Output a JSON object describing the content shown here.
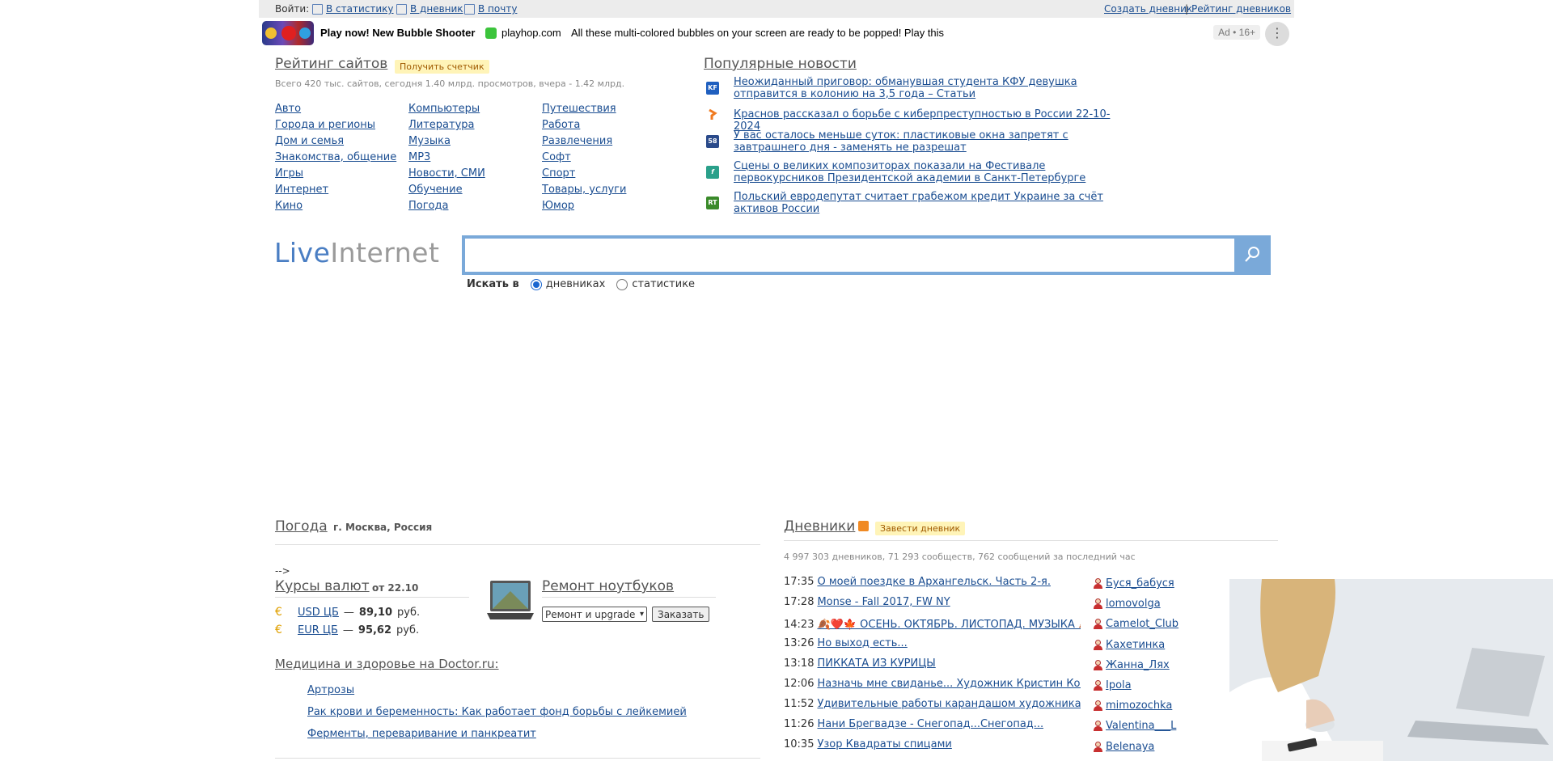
{
  "topbar": {
    "login_label": "Войти:",
    "links": [
      "В статистику",
      "В дневник",
      "В почту"
    ],
    "right_links": [
      "Создать дневник",
      "Рейтинг дневников"
    ],
    "separator": "|"
  },
  "ad": {
    "title": "Play now! New Bubble Shooter",
    "domain": "playhop.com",
    "description": "All these multi-colored bubbles on your screen are ready to be popped! Play this",
    "badge": "Ad • 16+",
    "menu_icon": "⋮"
  },
  "rating": {
    "title": "Рейтинг сайтов",
    "counter_button": "Получить счетчик",
    "stats": "Всего 420 тыс. сайтов, сегодня 1.40 млрд. просмотров, вчера - 1.42 млрд.",
    "categories": [
      [
        "Авто",
        "Города и регионы",
        "Дом и семья",
        "Знакомства, общение",
        "Игры",
        "Интернет",
        "Кино"
      ],
      [
        "Компьютеры",
        "Литература",
        "Музыка",
        "MP3",
        "Новости, СМИ",
        "Обучение",
        "Погода"
      ],
      [
        "Путешествия",
        "Работа",
        "Развлечения",
        "Софт",
        "Спорт",
        "Товары, услуги",
        "Юмор"
      ]
    ]
  },
  "news": {
    "title": "Популярные новости",
    "items": [
      {
        "text": "Неожиданный приговор: обманувшая студента КФУ девушка отправится в колонию на 3,5 года – Статьи",
        "icon": "KF",
        "color": "#1f5fbf"
      },
      {
        "text": "Краснов рассказал о борьбе с киберпреступностью в России 22-10-2024",
        "icon": "",
        "color": "#f07a20"
      },
      {
        "text": "У вас осталось меньше суток: пластиковые окна запретят с завтрашнего дня - заменять не разрешат",
        "icon": "58",
        "color": "#2a4a8a"
      },
      {
        "text": "Сцены о великих композиторах показали на Фестивале первокурсников Президентской академии в Санкт-Петербурге",
        "icon": "f",
        "color": "#2aa08a"
      },
      {
        "text": "Польский евродепутат считает грабежом кредит Украине за счёт активов России",
        "icon": "RT",
        "color": "#3a8a2a"
      }
    ]
  },
  "search": {
    "logo_live": "Live",
    "logo_internet": "Internet",
    "placeholder": "",
    "label": "Искать в",
    "option_diaries": "дневниках",
    "option_stats": "статистике",
    "search_icon": "magnifier-icon"
  },
  "weather": {
    "title": "Погода",
    "city": "г. Москва, Россия",
    "stray": "-->"
  },
  "currency": {
    "title": "Курсы валют",
    "date": "от 22.10",
    "rates": [
      {
        "label": "USD ЦБ",
        "dash": "—",
        "value": "89,10",
        "unit": "руб."
      },
      {
        "label": "EUR ЦБ",
        "dash": "—",
        "value": "95,62",
        "unit": "руб."
      }
    ]
  },
  "repair": {
    "title": "Ремонт ноутбуков",
    "select_value": "Ремонт и upgrade",
    "button": "Заказать"
  },
  "medicine": {
    "title": "Медицина и здоровье на Doctor.ru:",
    "links": [
      "Артрозы",
      "Рак крови и беременность: Как работает фонд борьбы с лейкемией",
      "Ферменты, переваривание и панкреатит"
    ]
  },
  "diaries": {
    "title": "Дневники",
    "create_button": "Завести дневник",
    "stats": "4 997 303 дневников, 71 293 сообществ, 762 сообщений за последний час",
    "posts": [
      {
        "time": "17:35",
        "title": "О моей поездке в Архангельск. Часть 2-я."
      },
      {
        "time": "17:28",
        "title": "Monse - Fall 2017, FW NY"
      },
      {
        "time": "14:23",
        "title": "🍂❤️🍁 ОСЕНЬ. ОКТЯБРЬ. ЛИСТОПАД. МУЗЫКА 🍂❤️"
      },
      {
        "time": "13:26",
        "title": "Но выход есть..."
      },
      {
        "time": "13:18",
        "title": "ПИККАТА ИЗ КУРИЦЫ"
      },
      {
        "time": "12:06",
        "title": "Назначь мне свиданье... Художник Кристин Комин (Ch"
      },
      {
        "time": "11:52",
        "title": "Удивительные работы карандашом художника Джера"
      },
      {
        "time": "11:26",
        "title": "Нани Брегвадзе - Снегопад...Снегопад..."
      },
      {
        "time": "10:35",
        "title": "Узор Квадраты спицами"
      }
    ],
    "users": [
      "Буся_бабуся",
      "lomovolga",
      "Camelot_Club",
      "Кахетинка",
      "Жанна_Лях",
      "Ipola",
      "mimozochka",
      "Valentina___L",
      "Belenaya"
    ]
  }
}
